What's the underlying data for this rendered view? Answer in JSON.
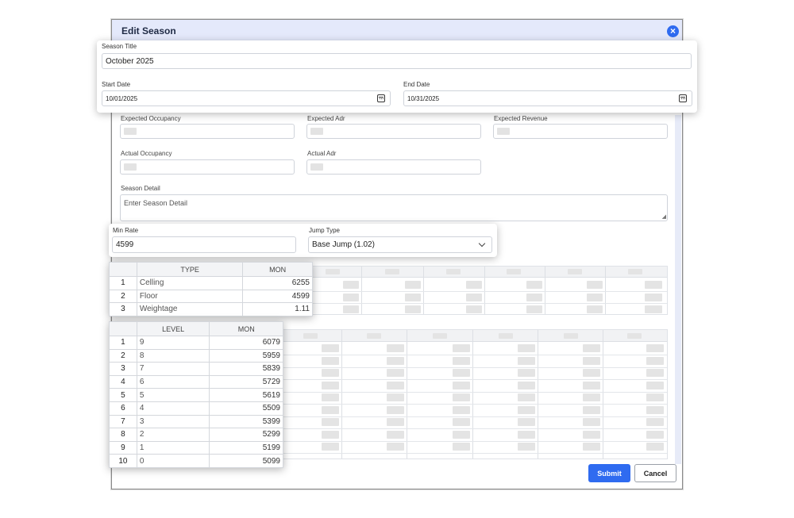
{
  "dialog": {
    "title": "Edit Season",
    "close_icon": "close-icon"
  },
  "season": {
    "title_label": "Season Title",
    "title_value": "October 2025",
    "start_label": "Start Date",
    "start_value": "10/01/2025",
    "end_label": "End Date",
    "end_value": "10/31/2025",
    "calendar_icon": "calendar-icon"
  },
  "metrics": {
    "expected_occupancy_label": "Expected Occupancy",
    "expected_adr_label": "Expected Adr",
    "expected_revenue_label": "Expected Revenue",
    "actual_occupancy_label": "Actual Occupancy",
    "actual_adr_label": "Actual Adr"
  },
  "detail": {
    "label": "Season Detail",
    "placeholder": "Enter Season Detail"
  },
  "rate": {
    "min_label": "Min Rate",
    "min_value": "4599",
    "jump_label": "Jump Type",
    "jump_value": "Base Jump (1.02)",
    "chevron_icon": "chevron-down-icon"
  },
  "type_table": {
    "headers": [
      "",
      "TYPE",
      "MON"
    ],
    "rows": [
      {
        "num": "1",
        "type": "Celling",
        "mon": "6255"
      },
      {
        "num": "2",
        "type": "Floor",
        "mon": "4599"
      },
      {
        "num": "3",
        "type": "Weightage",
        "mon": "1.11"
      }
    ]
  },
  "level_table": {
    "headers": [
      "",
      "LEVEL",
      "MON"
    ],
    "rows": [
      {
        "num": "1",
        "level": "9",
        "mon": "6079"
      },
      {
        "num": "2",
        "level": "8",
        "mon": "5959"
      },
      {
        "num": "3",
        "level": "7",
        "mon": "5839"
      },
      {
        "num": "4",
        "level": "6",
        "mon": "5729"
      },
      {
        "num": "5",
        "level": "5",
        "mon": "5619"
      },
      {
        "num": "6",
        "level": "4",
        "mon": "5509"
      },
      {
        "num": "7",
        "level": "3",
        "mon": "5399"
      },
      {
        "num": "8",
        "level": "2",
        "mon": "5299"
      },
      {
        "num": "9",
        "level": "1",
        "mon": "5199"
      },
      {
        "num": "10",
        "level": "0",
        "mon": "5099"
      }
    ]
  },
  "footer": {
    "submit_label": "Submit",
    "cancel_label": "Cancel"
  },
  "colors": {
    "accent": "#2f6bf0",
    "header_bg": "#e4e9fb"
  }
}
